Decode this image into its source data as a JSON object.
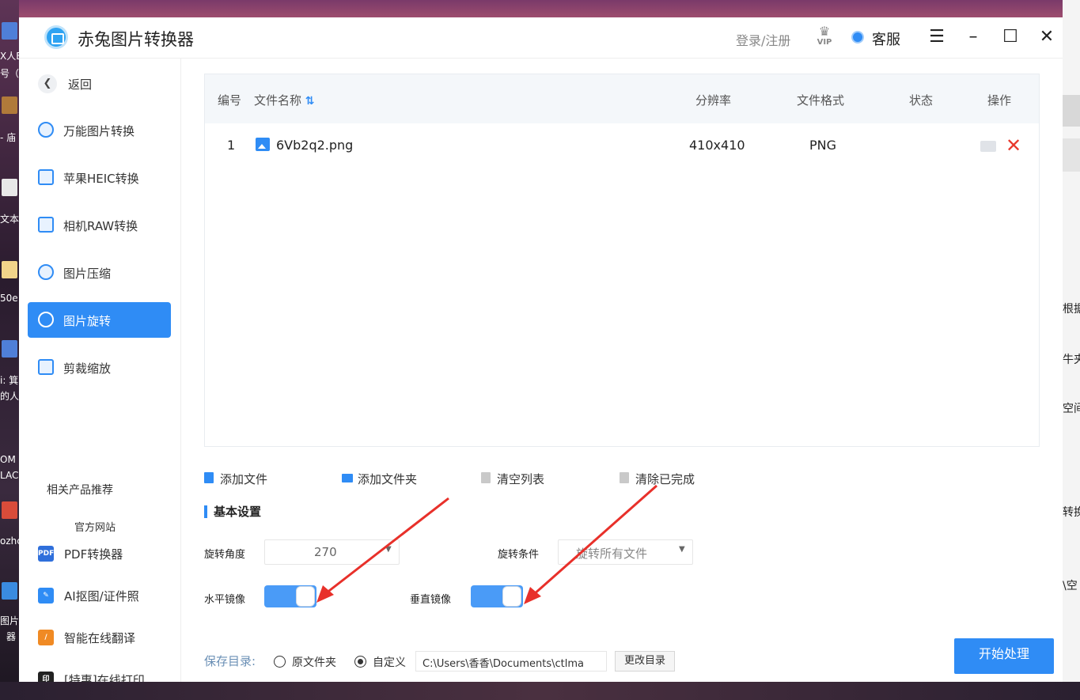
{
  "app": {
    "title": "赤兔图片转换器",
    "login": "登录/注册",
    "vip": "VIP",
    "service": "客服"
  },
  "window_controls": {
    "menu": "☰",
    "minimize": "–",
    "maximize": "☐",
    "close": "✕"
  },
  "sidebar": {
    "back": "返回",
    "items": [
      {
        "label": "万能图片转换",
        "icon": "image-convert-icon",
        "active": false
      },
      {
        "label": "苹果HEIC转换",
        "icon": "heic-icon",
        "active": false
      },
      {
        "label": "相机RAW转换",
        "icon": "raw-icon",
        "active": false
      },
      {
        "label": "图片压缩",
        "icon": "compress-icon",
        "active": false
      },
      {
        "label": "图片旋转",
        "icon": "rotate-icon",
        "active": true
      },
      {
        "label": "剪裁缩放",
        "icon": "crop-icon",
        "active": false
      }
    ],
    "related_title": "相关产品推荐",
    "official_site": "官方网站",
    "products": [
      {
        "label": "PDF转换器",
        "badge": "PDF",
        "color": "#2f6fdb"
      },
      {
        "label": "AI抠图/证件照",
        "badge": "✎",
        "color": "#2f8cf5"
      },
      {
        "label": "智能在线翻译",
        "badge": "/",
        "color": "#f08a24"
      },
      {
        "label": "[特惠]在线打印",
        "badge": "印",
        "color": "#222222"
      }
    ]
  },
  "table": {
    "headers": {
      "index": "编号",
      "name": "文件名称",
      "sort": "⇅",
      "resolution": "分辨率",
      "format": "文件格式",
      "status": "状态",
      "action": "操作"
    },
    "rows": [
      {
        "index": "1",
        "name": "6Vb2q2.png",
        "resolution": "410x410",
        "format": "PNG",
        "status": ""
      }
    ]
  },
  "toolbar": {
    "add_file": "添加文件",
    "add_folder": "添加文件夹",
    "clear_list": "清空列表",
    "clear_done": "清除已完成"
  },
  "settings": {
    "title": "基本设置",
    "rotate_angle_label": "旋转角度",
    "rotate_angle_value": "270",
    "rotate_condition_label": "旋转条件",
    "rotate_condition_value": "旋转所有文件",
    "horizontal_mirror_label": "水平镜像",
    "horizontal_mirror_on": true,
    "vertical_mirror_label": "垂直镜像",
    "vertical_mirror_on": true
  },
  "save": {
    "label": "保存目录:",
    "option_original": "原文件夹",
    "option_custom": "自定义",
    "selected": "custom",
    "path": "C:\\Users\\香香\\Documents\\ctlma",
    "change_button": "更改目录"
  },
  "start_button": "开始处理",
  "colors": {
    "accent": "#2f8cf5",
    "delete": "#e8382c",
    "arrow": "#e8302a"
  },
  "desktop": {
    "left_texts": [
      "X人E",
      "号（i",
      "- 庙",
      "文本",
      "50e",
      "i:  箕",
      "的人",
      "OM",
      "LAC",
      "ozhc",
      "图片",
      "器"
    ],
    "right_texts": [
      "根据",
      "牛夹",
      "空间",
      "转换",
      "\\空"
    ]
  }
}
